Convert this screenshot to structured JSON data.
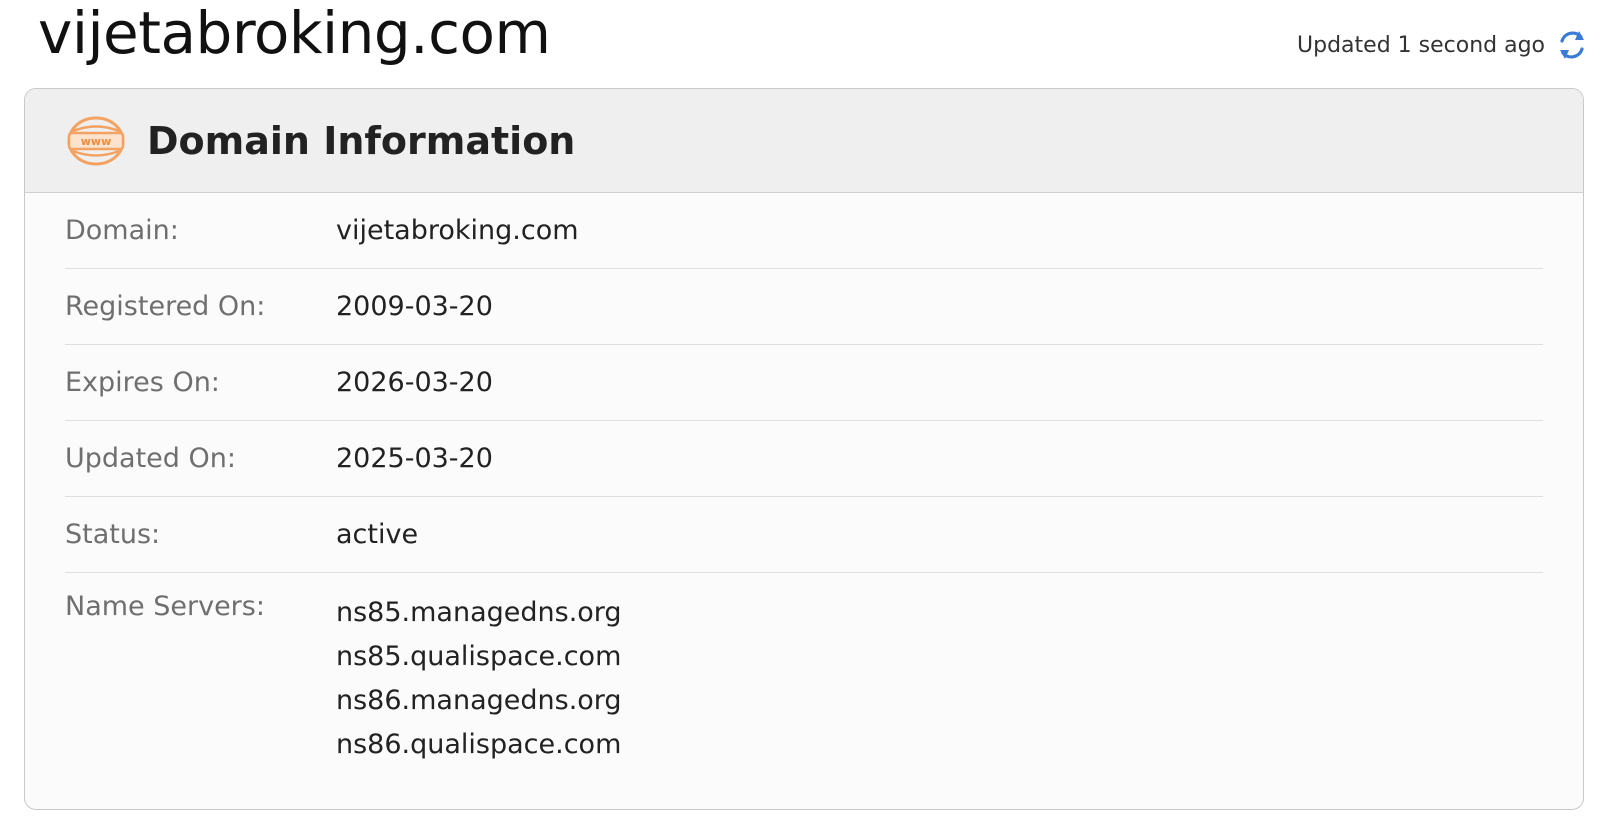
{
  "page": {
    "title": "vijetabroking.com",
    "updated_text": "Updated 1 second ago"
  },
  "icons": {
    "refresh": "refresh-icon",
    "www": "www-icon"
  },
  "colors": {
    "accent_blue": "#3a7bd5",
    "www_orange": "#f4a261"
  },
  "card": {
    "title": "Domain Information",
    "rows": [
      {
        "label": "Domain:",
        "value": "vijetabroking.com"
      },
      {
        "label": "Registered On:",
        "value": "2009-03-20"
      },
      {
        "label": "Expires On:",
        "value": "2026-03-20"
      },
      {
        "label": "Updated On:",
        "value": "2025-03-20"
      },
      {
        "label": "Status:",
        "value": "active"
      }
    ],
    "name_servers": {
      "label": "Name Servers:",
      "values": [
        "ns85.managedns.org",
        "ns85.qualispace.com",
        "ns86.managedns.org",
        "ns86.qualispace.com"
      ]
    }
  }
}
